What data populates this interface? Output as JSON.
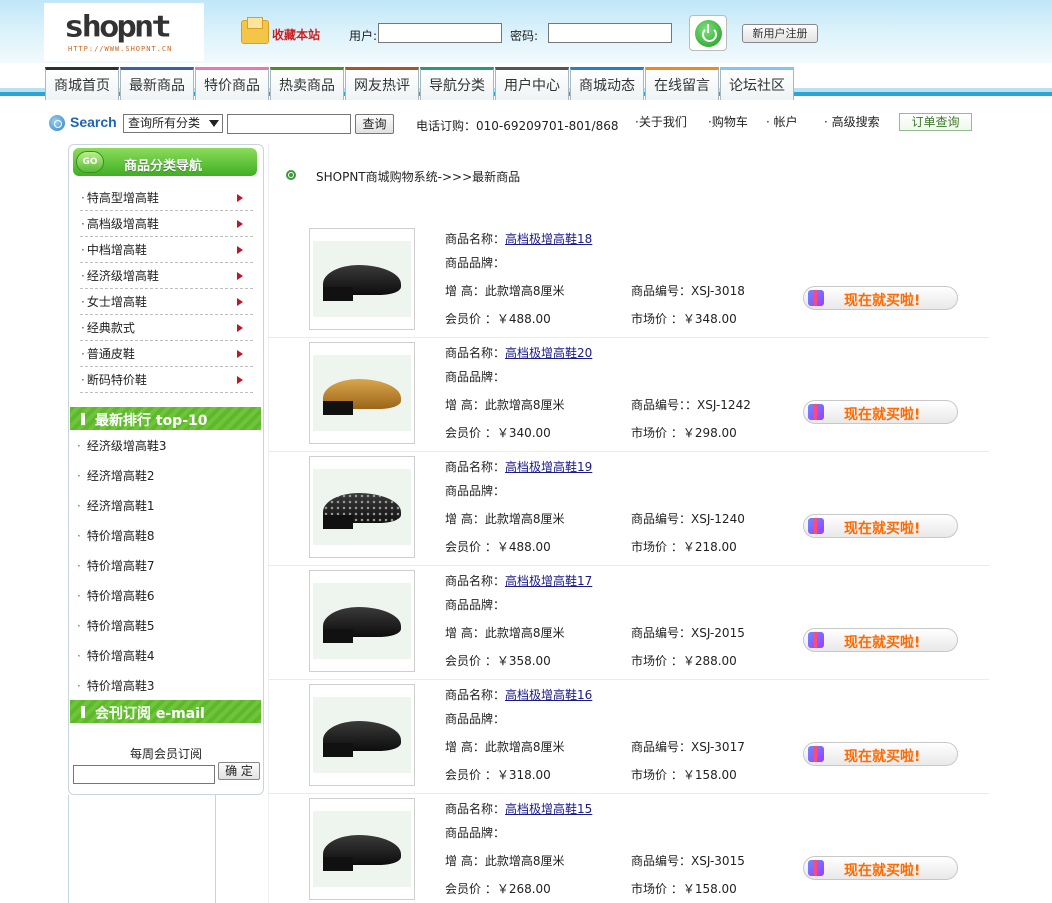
{
  "header": {
    "logo_text": "shopnt",
    "logo_url": "HTTP://WWW.SHOPNT.CN",
    "favorite_label": "收藏本站",
    "user_label": "用户:",
    "password_label": "密码:",
    "register_label": "新用户注册"
  },
  "nav": {
    "items": [
      {
        "label": "商城首页",
        "color": "#2f2f2f"
      },
      {
        "label": "最新商品",
        "color": "#3a5ea8"
      },
      {
        "label": "特价商品",
        "color": "#e37ab0"
      },
      {
        "label": "热卖商品",
        "color": "#4a8f2a"
      },
      {
        "label": "网友热评",
        "color": "#9b5a2a"
      },
      {
        "label": "导航分类",
        "color": "#2a9a74"
      },
      {
        "label": "用户中心",
        "color": "#555555"
      },
      {
        "label": "商城动态",
        "color": "#2a7fc4"
      },
      {
        "label": "在线留言",
        "color": "#f08a1c"
      },
      {
        "label": "论坛社区",
        "color": "#7fc7f2"
      }
    ]
  },
  "searchbar": {
    "search_label": "Search",
    "category_selected": "查询所有分类",
    "query_button": "查询",
    "phone": "电话订购：010-69209701-801/868",
    "links": [
      "·关于我们",
      "·购物车",
      "· 帐户",
      "· 高级搜索"
    ],
    "order_query": "订单查询"
  },
  "sidebar": {
    "go_badge": "GO",
    "category_title": "商品分类导航",
    "categories": [
      "特高型增高鞋",
      "高档级增高鞋",
      "中档增高鞋",
      "经济级增高鞋",
      "女士增高鞋",
      "经典款式",
      "普通皮鞋",
      "断码特价鞋"
    ],
    "category_bullet": "·",
    "ranking_title": "最新排行   top-10",
    "ranking_bullet": "·",
    "ranking": [
      "经济级增高鞋3",
      "经济增高鞋2",
      "经济增高鞋1",
      "特价增高鞋8",
      "特价增高鞋7",
      "特价增高鞋6",
      "特价增高鞋5",
      "特价增高鞋4",
      "特价增高鞋3"
    ],
    "mail_title": "会刊订阅   e-mail",
    "mail_caption": "每周会员订阅",
    "mail_button": "确 定"
  },
  "main": {
    "breadcrumb": "SHOPNT商城购物系统->>>最新商品",
    "labels": {
      "name": "商品名称：",
      "brand": "商品品牌：",
      "height": "增 高：此款增高8厘米",
      "code": "商品编号：",
      "member": "会员价 ：￥",
      "market": "市场价 ：￥",
      "buy": "现在就买啦!"
    },
    "products": [
      {
        "name": "高档极增高鞋18",
        "code": "XSJ-3018",
        "member_price": "488.00",
        "market_price": "348.00",
        "shoe": "black"
      },
      {
        "name": "高档极增高鞋20",
        "code": "：XSJ-1242",
        "member_price": "340.00",
        "market_price": "298.00",
        "shoe": "tan"
      },
      {
        "name": "高档极增高鞋19",
        "code": "XSJ-1240",
        "member_price": "488.00",
        "market_price": "218.00",
        "shoe": "perf"
      },
      {
        "name": "高档极增高鞋17",
        "code": "XSJ-2015",
        "member_price": "358.00",
        "market_price": "288.00",
        "shoe": "black"
      },
      {
        "name": "高档极增高鞋16",
        "code": "XSJ-3017",
        "member_price": "318.00",
        "market_price": "158.00",
        "shoe": "black"
      },
      {
        "name": "高档极增高鞋15",
        "code": "XSJ-3015",
        "member_price": "268.00",
        "market_price": "158.00",
        "shoe": "black"
      }
    ]
  }
}
